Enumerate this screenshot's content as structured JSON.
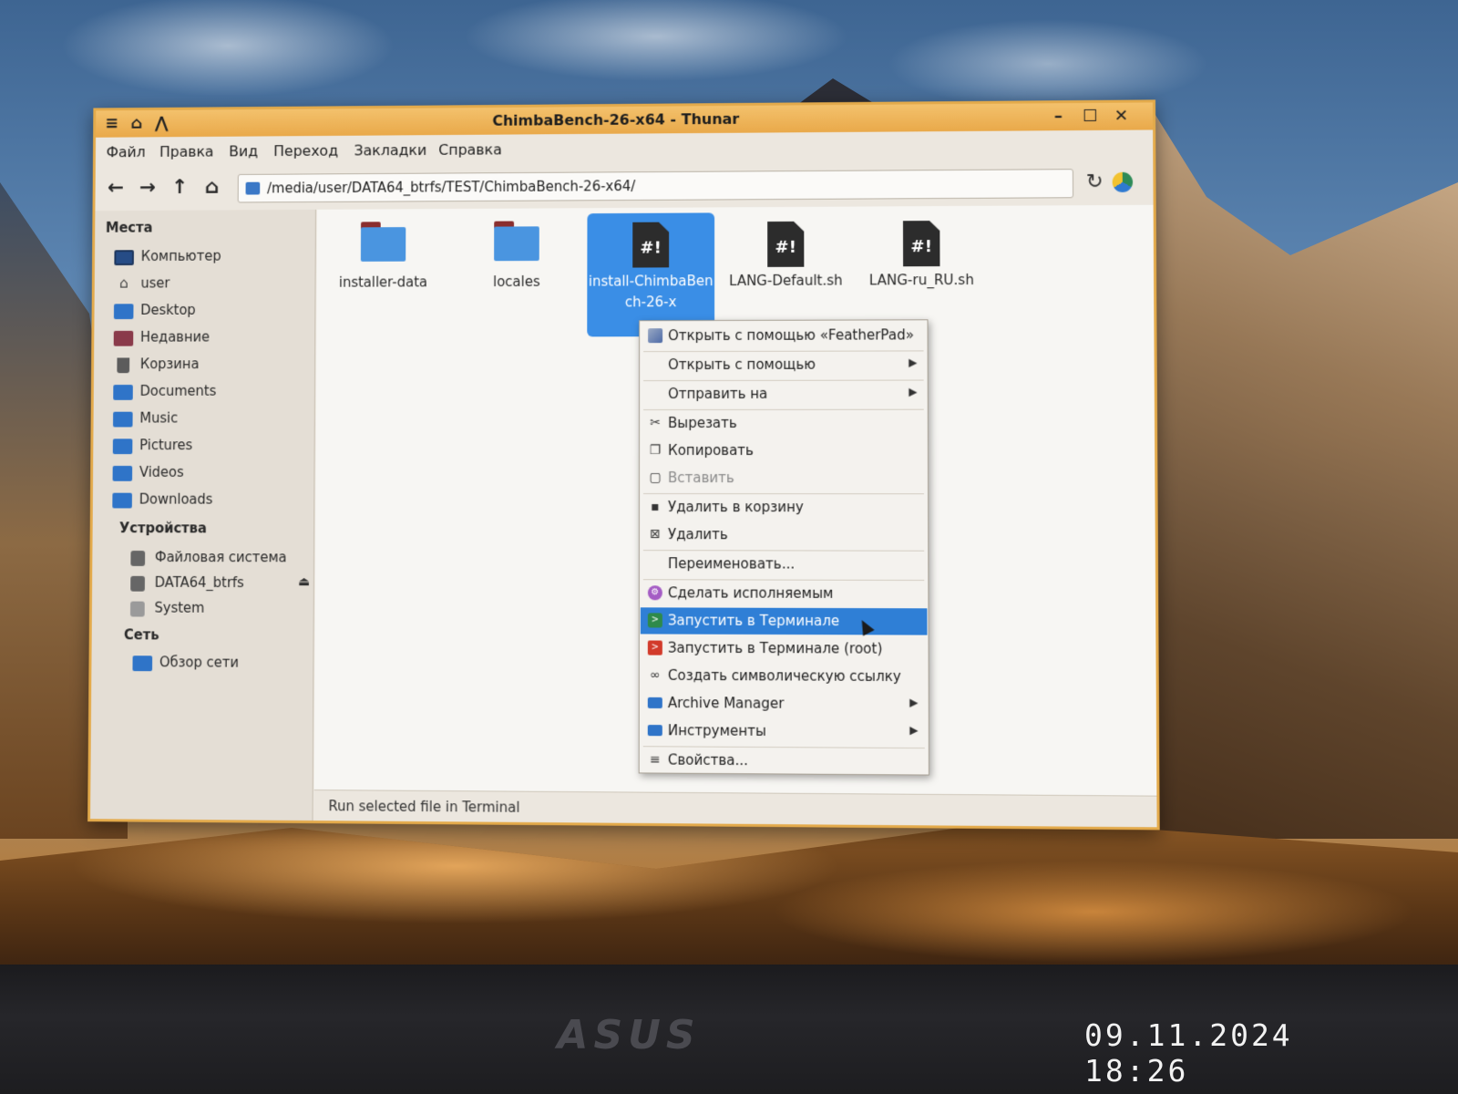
{
  "window": {
    "title": "ChimbaBench-26-x64 - Thunar",
    "controls": {
      "minimize": "–",
      "maximize": "☐",
      "close": "✕"
    }
  },
  "menubar": [
    "Файл",
    "Правка",
    "Вид",
    "Переход",
    "Закладки",
    "Справка"
  ],
  "toolbar": {
    "path": "/media/user/DATA64_btrfs/TEST/ChimbaBench-26-x64/"
  },
  "sidebar": {
    "places_header": "Места",
    "places": [
      "Компьютер",
      "user",
      "Desktop",
      "Недавние",
      "Корзина",
      "Documents",
      "Music",
      "Pictures",
      "Videos",
      "Downloads"
    ],
    "devices_header": "Устройства",
    "devices": [
      "Файловая система",
      "DATA64_btrfs",
      "System"
    ],
    "network_header": "Сеть",
    "network": [
      "Обзор сети"
    ]
  },
  "files": [
    {
      "name": "installer-data",
      "type": "folder"
    },
    {
      "name": "locales",
      "type": "folder"
    },
    {
      "name": "install-ChimbaBench-26-x",
      "type": "script",
      "selected": true
    },
    {
      "name": "LANG-Default.sh",
      "type": "script"
    },
    {
      "name": "LANG-ru_RU.sh",
      "type": "script"
    }
  ],
  "script_glyph": "#!",
  "context_menu": [
    "Открыть с помощью «FeatherPad»",
    "Открыть с помощью",
    "Отправить на",
    "Вырезать",
    "Копировать",
    "Вставить",
    "Удалить в корзину",
    "Удалить",
    "Переименовать...",
    "Сделать исполняемым",
    "Запустить в Терминале",
    "Запустить в Терминале (root)",
    "Создать символическую ссылку",
    "Archive Manager",
    "Инструменты",
    "Свойства..."
  ],
  "status": "Run selected file in Terminal",
  "photo": {
    "bezel_logo": "ASUS",
    "timestamp": "09.11.2024 18:26"
  },
  "colors": {
    "titlebar": "#e9a94a",
    "selection": "#2f7fd6",
    "folder": "#4a95e0"
  }
}
